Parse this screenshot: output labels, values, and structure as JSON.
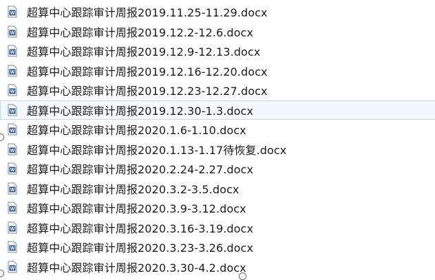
{
  "files": [
    {
      "name": "超算中心跟踪审计周报2019.11.25-11.29.docx",
      "selected": false
    },
    {
      "name": "超算中心跟踪审计周报2019.12.2-12.6.docx",
      "selected": false
    },
    {
      "name": "超算中心跟踪审计周报2019.12.9-12.13.docx",
      "selected": false
    },
    {
      "name": "超算中心跟踪审计周报2019.12.16-12.20.docx",
      "selected": false
    },
    {
      "name": "超算中心跟踪审计周报2019.12.23-12.27.docx",
      "selected": false
    },
    {
      "name": "超算中心跟踪审计周报2019.12.30-1.3.docx",
      "selected": true
    },
    {
      "name": "超算中心跟踪审计周报2020.1.6-1.10.docx",
      "selected": false
    },
    {
      "name": "超算中心跟踪审计周报2020.1.13-1.17待恢复.docx",
      "selected": false
    },
    {
      "name": "超算中心跟踪审计周报2020.2.24-2.27.docx",
      "selected": false
    },
    {
      "name": "超算中心跟踪审计周报2020.3.2-3.5.docx",
      "selected": false
    },
    {
      "name": "超算中心跟踪审计周报2020.3.9-3.12.docx",
      "selected": false
    },
    {
      "name": "超算中心跟踪审计周报2020.3.16-3.19.docx",
      "selected": false
    },
    {
      "name": "超算中心跟踪审计周报2020.3.23-3.26.docx",
      "selected": false
    },
    {
      "name": "超算中心跟踪审计周报2020.3.30-4.2.docx",
      "selected": false
    }
  ],
  "icon": "word-document-icon",
  "colors": {
    "icon_blue": "#2b5797",
    "selection_bg": "#f3f8fd",
    "selection_border": "#c7d9ee"
  }
}
